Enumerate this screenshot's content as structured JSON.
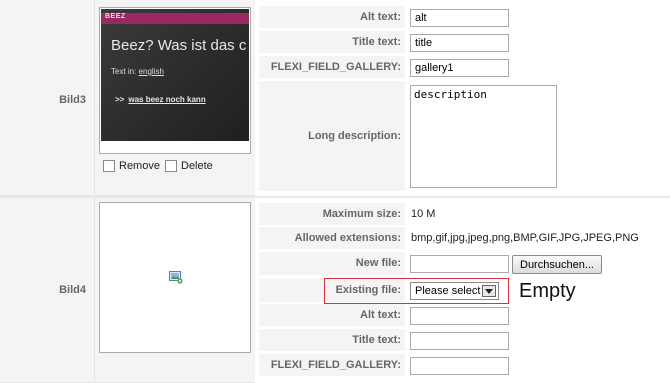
{
  "rows": [
    {
      "label": "Bild3",
      "preview": {
        "brand": "BEEZ",
        "title": "Beez? Was ist das c",
        "text_in_prefix": "Text in:",
        "text_in_link": "english",
        "link_arrow": ">>",
        "link_text": "was beez noch kann"
      },
      "checkboxes": [
        {
          "label": "Remove",
          "checked": false
        },
        {
          "label": "Delete",
          "checked": false
        }
      ],
      "fields": {
        "alt_label": "Alt text:",
        "alt_value": "alt",
        "title_label": "Title text:",
        "title_value": "title",
        "gallery_label": "FLEXI_FIELD_GALLERY:",
        "gallery_value": "gallery1",
        "long_desc_label": "Long description:",
        "long_desc_value": "description"
      }
    },
    {
      "label": "Bild4",
      "placeholder_icon": "image-add-icon",
      "fields": {
        "max_size_label": "Maximum size:",
        "max_size_value": "10 M",
        "allowed_ext_label": "Allowed extensions:",
        "allowed_ext_value": "bmp,gif,jpg,jpeg,png,BMP,GIF,JPG,JPEG,PNG",
        "new_file_label": "New file:",
        "new_file_value": "",
        "browse_label": "Durchsuchen...",
        "existing_file_label": "Existing file:",
        "existing_file_value": "Please select",
        "alt_label": "Alt text:",
        "alt_value": "",
        "title_label": "Title text:",
        "title_value": "",
        "gallery_label": "FLEXI_FIELD_GALLERY:",
        "gallery_value": ""
      }
    }
  ],
  "annotation": "Empty",
  "colors": {
    "highlight_border": "#d9323a",
    "brand_bar": "#9a2863",
    "label_bg": "#f4f4f4"
  }
}
